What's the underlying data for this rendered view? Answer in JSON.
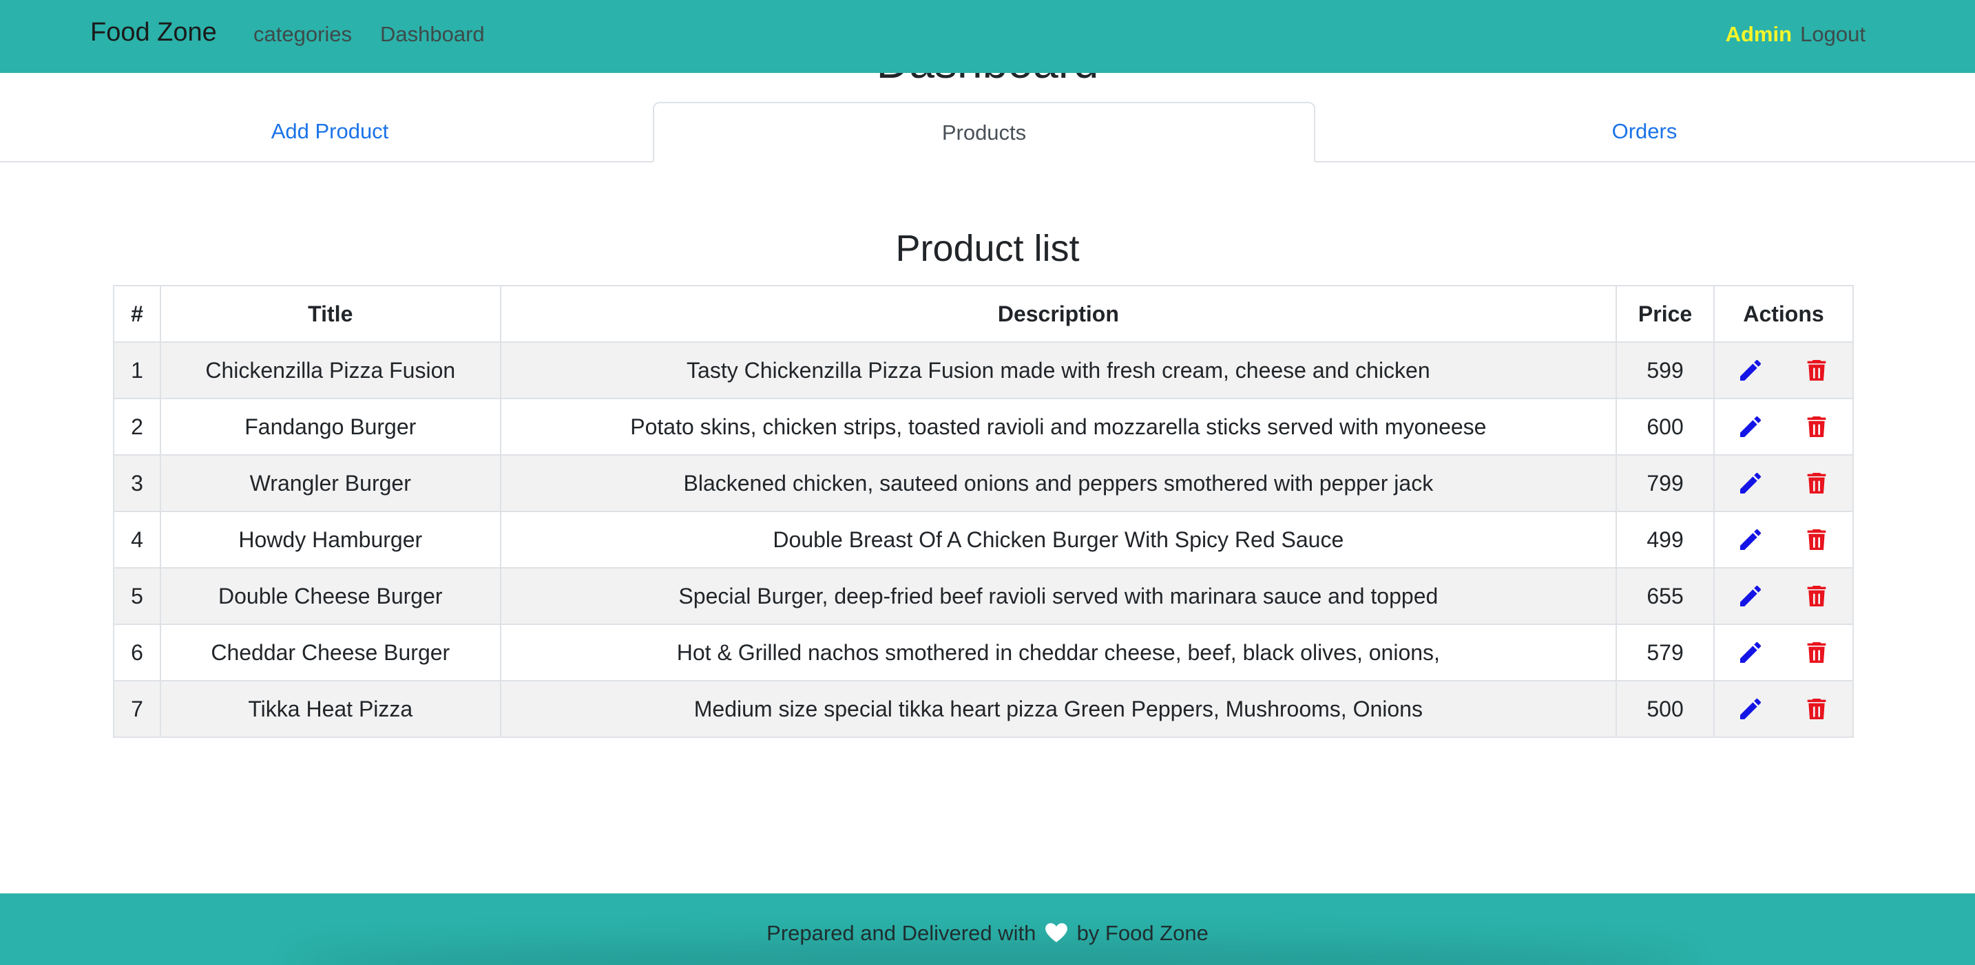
{
  "navbar": {
    "brand": "Food Zone",
    "links": [
      "categories",
      "Dashboard"
    ],
    "admin": "Admin",
    "logout": "Logout"
  },
  "page": {
    "heading": "Dashboard"
  },
  "tabs": [
    {
      "label": "Add Product",
      "active": false
    },
    {
      "label": "Products",
      "active": true
    },
    {
      "label": "Orders",
      "active": false
    }
  ],
  "product_list": {
    "title": "Product list",
    "columns": [
      "#",
      "Title",
      "Description",
      "Price",
      "Actions"
    ],
    "rows": [
      {
        "num": "1",
        "title": "Chickenzilla Pizza Fusion",
        "description": "Tasty Chickenzilla Pizza Fusion made with fresh cream, cheese and chicken",
        "price": "599"
      },
      {
        "num": "2",
        "title": "Fandango Burger",
        "description": "Potato skins, chicken strips, toasted ravioli and mozzarella sticks served with myoneese",
        "price": "600"
      },
      {
        "num": "3",
        "title": "Wrangler Burger",
        "description": "Blackened chicken, sauteed onions and peppers smothered with pepper jack",
        "price": "799"
      },
      {
        "num": "4",
        "title": "Howdy Hamburger",
        "description": "Double Breast Of A Chicken Burger With Spicy Red Sauce",
        "price": "499"
      },
      {
        "num": "5",
        "title": "Double Cheese Burger",
        "description": "Special Burger, deep-fried beef ravioli served with marinara sauce and topped",
        "price": "655"
      },
      {
        "num": "6",
        "title": "Cheddar Cheese Burger",
        "description": "Hot & Grilled nachos smothered in cheddar cheese, beef, black olives, onions,",
        "price": "579"
      },
      {
        "num": "7",
        "title": "Tikka Heat Pizza",
        "description": "Medium size special tikka heart pizza Green Peppers, Mushrooms, Onions",
        "price": "500"
      }
    ],
    "action_icons": [
      "pencil-icon",
      "trash-icon"
    ]
  },
  "footer": {
    "text_before": "Prepared and Delivered with",
    "icon": "heart-icon",
    "text_after": "by Food Zone"
  },
  "colors": {
    "navbar_bg": "#2bb2aa",
    "admin_text": "#f5f52a",
    "link_blue": "#1a73e8",
    "edit_icon": "#1414e6",
    "delete_icon": "#e8141e"
  }
}
